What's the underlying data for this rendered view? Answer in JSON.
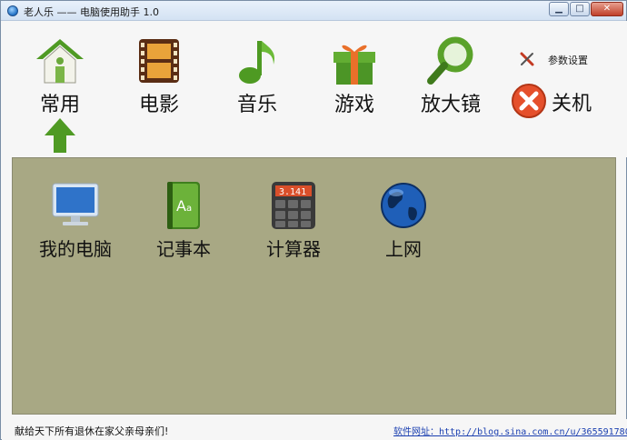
{
  "window": {
    "title": "老人乐 —— 电脑使用助手 1.0",
    "controls": {
      "minimize": "▁",
      "maximize": "□",
      "close": "✕"
    }
  },
  "toolbar": {
    "items": [
      {
        "label": "常用",
        "icon": "home-icon"
      },
      {
        "label": "电影",
        "icon": "film-icon"
      },
      {
        "label": "音乐",
        "icon": "music-note-icon"
      },
      {
        "label": "游戏",
        "icon": "gift-box-icon"
      },
      {
        "label": "放大镜",
        "icon": "magnifier-icon"
      }
    ],
    "settings_label": "参数设置",
    "shutdown_label": "关机"
  },
  "apps": [
    {
      "label": "我的电脑",
      "icon": "monitor-icon"
    },
    {
      "label": "记事本",
      "icon": "notebook-icon"
    },
    {
      "label": "计算器",
      "icon": "calculator-icon"
    },
    {
      "label": "上网",
      "icon": "globe-icon"
    }
  ],
  "calculator_display": "3.141",
  "status": {
    "left": "献给天下所有退休在家父亲母亲们!",
    "right": "软件网址：http://blog.sina.com.cn/u/3655917804"
  },
  "colors": {
    "panel_bg": "#a8a884",
    "green_accent": "#5aa22a",
    "link": "#1a3fb0"
  }
}
